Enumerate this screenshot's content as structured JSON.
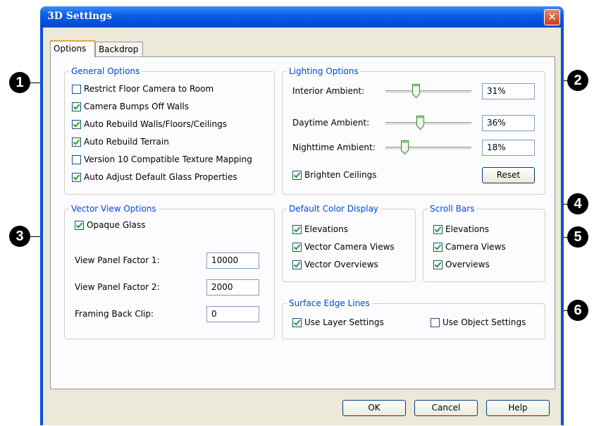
{
  "window": {
    "title": "3D Settings",
    "close_glyph": "✕"
  },
  "tabs": [
    "Options",
    "Backdrop"
  ],
  "general_options": {
    "title": "General Options",
    "items": [
      {
        "label": "Restrict Floor Camera to Room",
        "checked": false
      },
      {
        "label": "Camera Bumps Off Walls",
        "checked": true
      },
      {
        "label": "Auto Rebuild Walls/Floors/Ceilings",
        "checked": true
      },
      {
        "label": "Auto Rebuild Terrain",
        "checked": true
      },
      {
        "label": "Version 10 Compatible Texture Mapping",
        "checked": false
      },
      {
        "label": "Auto Adjust Default Glass Properties",
        "checked": true
      }
    ]
  },
  "lighting_options": {
    "title": "Lighting Options",
    "rows": [
      {
        "label": "Interior Ambient:",
        "value": "31%",
        "level": 0.31
      },
      {
        "label": "Daytime Ambient:",
        "value": "36%",
        "level": 0.36
      },
      {
        "label": "Nighttime Ambient:",
        "value": "18%",
        "level": 0.18
      }
    ],
    "brighten_ceilings": {
      "label": "Brighten Ceilings",
      "checked": true
    },
    "reset_label": "Reset"
  },
  "vector_view_options": {
    "title": "Vector View Options",
    "opaque_glass": {
      "label": "Opaque Glass",
      "checked": true
    },
    "fields": [
      {
        "label": "View Panel Factor 1:",
        "value": "10000"
      },
      {
        "label": "View Panel Factor 2:",
        "value": "2000"
      },
      {
        "label": "Framing Back Clip:",
        "value": "0"
      }
    ]
  },
  "default_color_display": {
    "title": "Default Color Display",
    "items": [
      {
        "label": "Elevations",
        "checked": true
      },
      {
        "label": "Vector Camera Views",
        "checked": true
      },
      {
        "label": "Vector Overviews",
        "checked": true
      }
    ]
  },
  "scroll_bars": {
    "title": "Scroll Bars",
    "items": [
      {
        "label": "Elevations",
        "checked": true
      },
      {
        "label": "Camera Views",
        "checked": true
      },
      {
        "label": "Overviews",
        "checked": true
      }
    ]
  },
  "surface_edge_lines": {
    "title": "Surface Edge Lines",
    "use_layer_settings": {
      "label": "Use Layer Settings",
      "checked": true
    },
    "use_object_settings": {
      "label": "Use Object Settings",
      "checked": false
    }
  },
  "footer": {
    "ok": "OK",
    "cancel": "Cancel",
    "help": "Help"
  },
  "callouts": [
    "1",
    "2",
    "3",
    "4",
    "5",
    "6"
  ],
  "colors": {
    "title_bar": "#0a50d8",
    "group_title": "#0046d5",
    "dialog_bg": "#ece9d8"
  }
}
